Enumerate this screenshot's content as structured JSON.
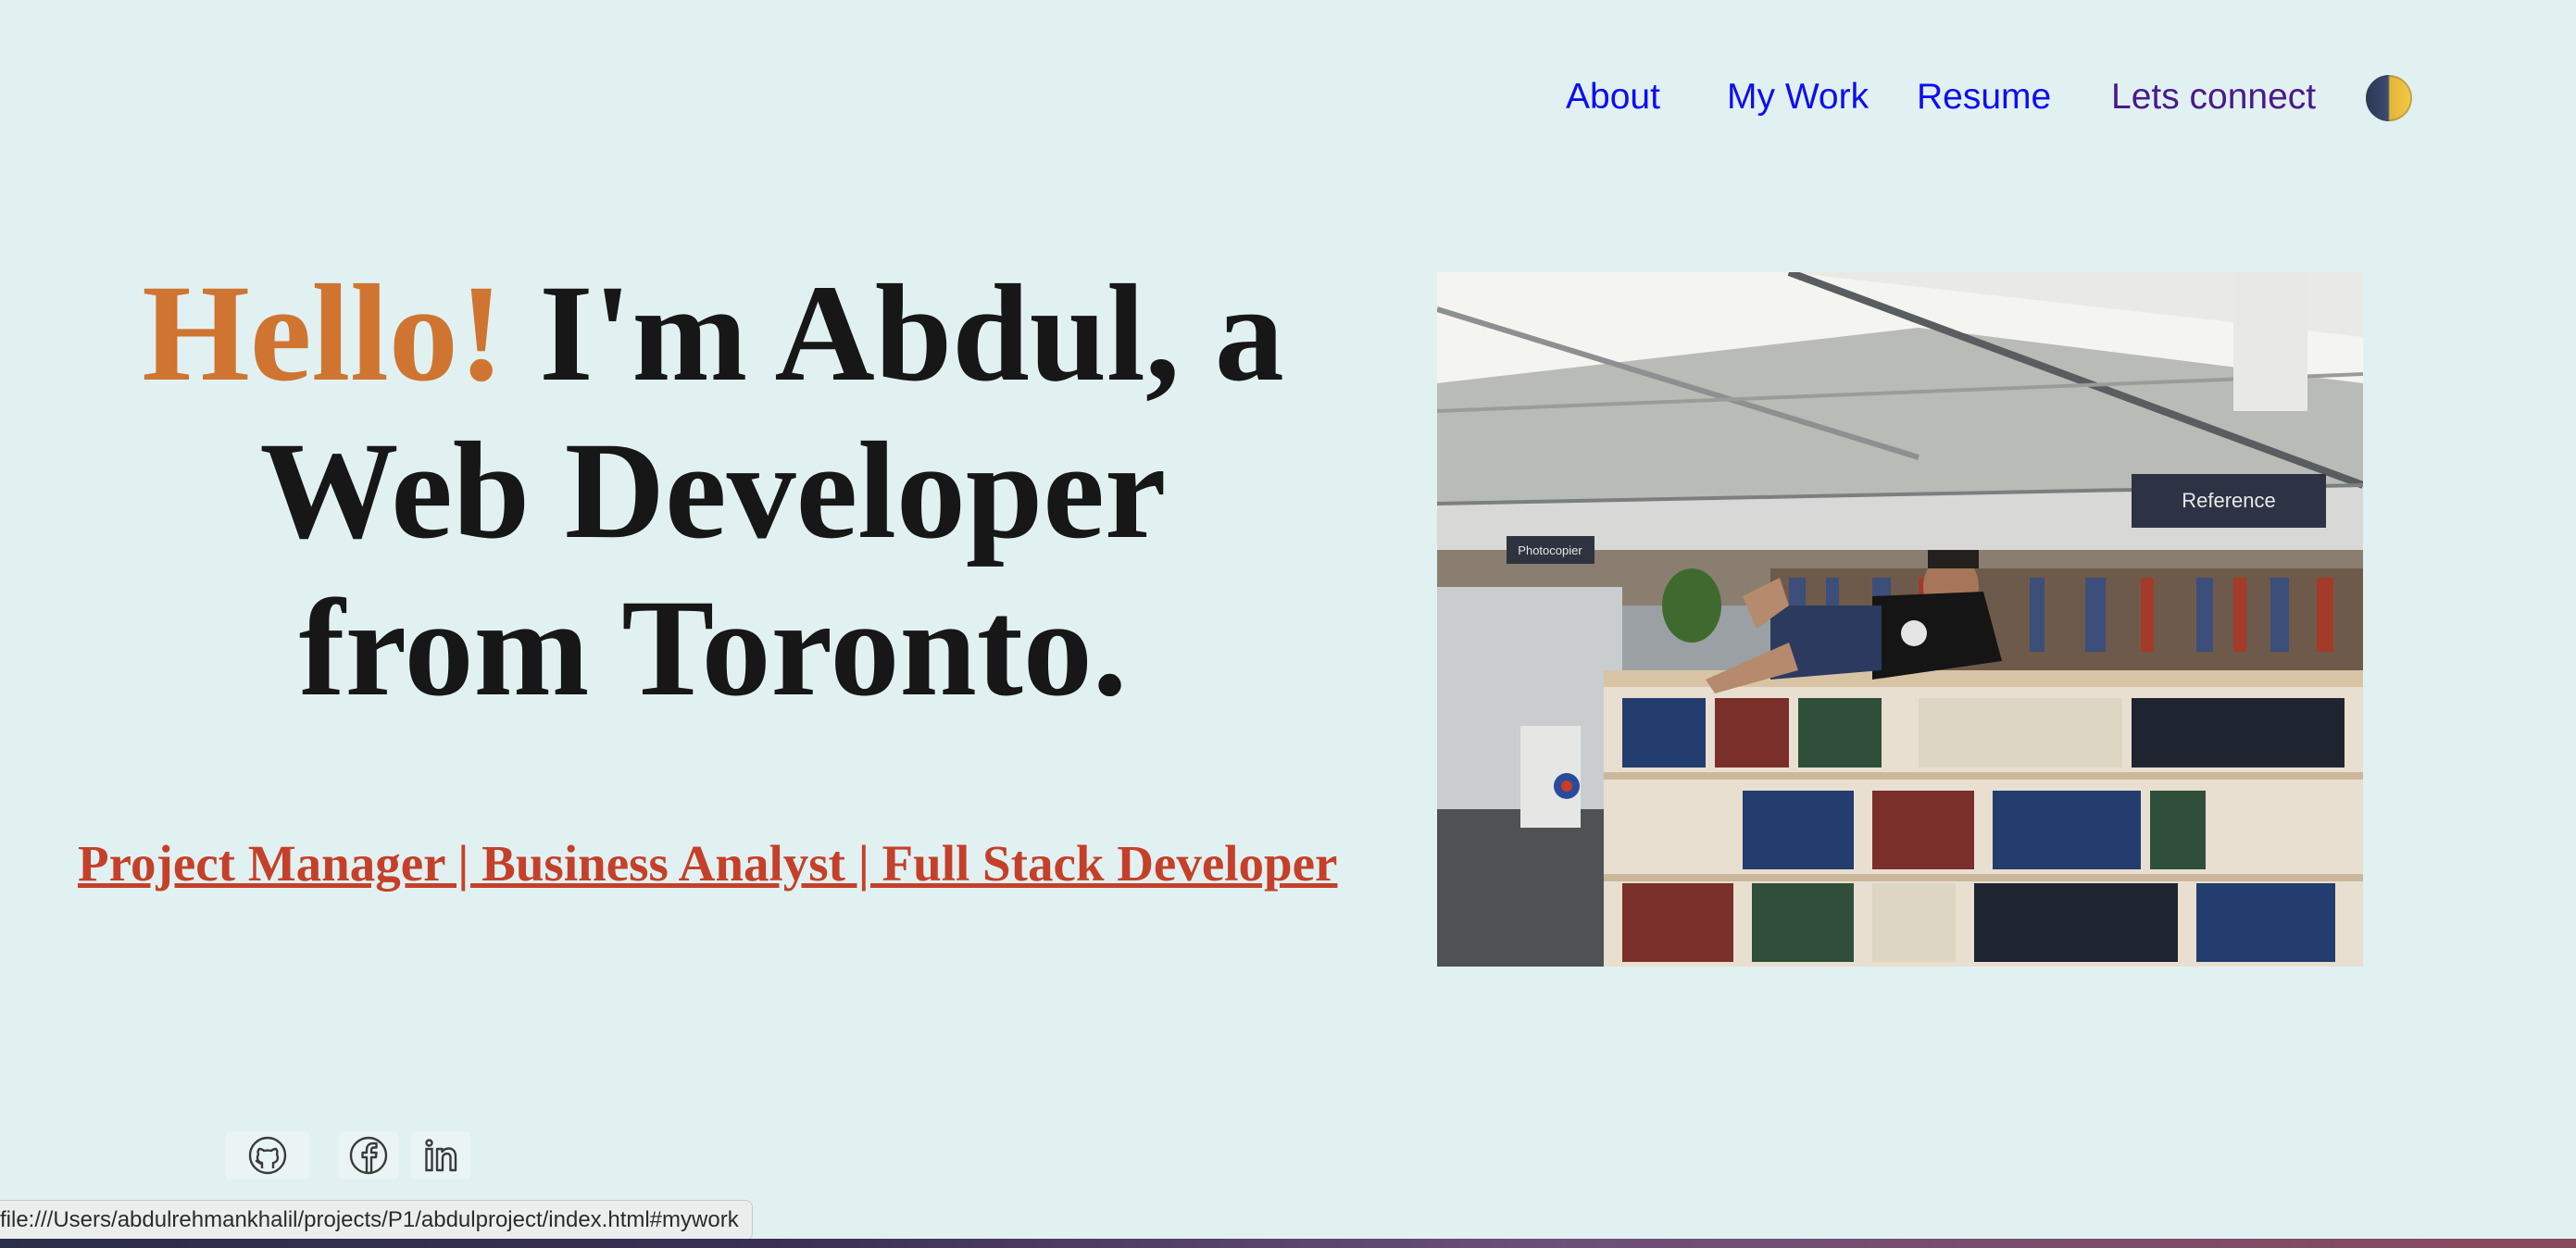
{
  "nav": {
    "about": "About",
    "my_work": "My Work",
    "resume": "Resume",
    "connect": "Lets connect",
    "theme_toggle_icon": "moon-sun-toggle-icon"
  },
  "hero": {
    "hello": "Hello!",
    "line1_rest": "I'm Abdul, a",
    "line2": "Web Developer",
    "line3": "from Toronto.",
    "roles": "Project Manager | Business Analyst | Full Stack Developer",
    "accent_color": "#cf7531",
    "roles_color": "#c5402a"
  },
  "photo": {
    "sign_reference": "Reference",
    "sign_photocopier": "Photocopier"
  },
  "social": {
    "icons": [
      "github-icon",
      "facebook-icon",
      "linkedin-icon"
    ]
  },
  "status_bar": {
    "url": "file:///Users/abdulrehmankhalil/projects/P1/abdulproject/index.html#mywork"
  },
  "colors": {
    "background": "#e1f1f1",
    "nav_link": "#0d0df2",
    "nav_visited": "#4a1a8a"
  }
}
